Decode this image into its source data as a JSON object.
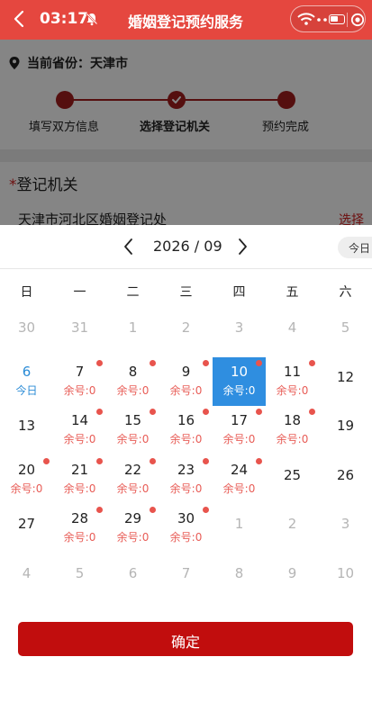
{
  "status_bar": {
    "time": "03:17"
  },
  "header": {
    "title": "婚姻登记预约服务"
  },
  "province": {
    "label": "当前省份：",
    "value": "天津市"
  },
  "steps": [
    {
      "label": "填写双方信息"
    },
    {
      "label": "选择登记机关"
    },
    {
      "label": "预约完成"
    }
  ],
  "registry": {
    "required_mark": "*",
    "label": "登记机关",
    "value": "天津市河北区婚姻登记处",
    "choose_label": "选择"
  },
  "calendar": {
    "month_title": "2026 / 09",
    "today_label": "今日",
    "weekdays": [
      "日",
      "一",
      "二",
      "三",
      "四",
      "五",
      "六"
    ],
    "days": [
      {
        "d": "30",
        "state": "muted"
      },
      {
        "d": "31",
        "state": "muted"
      },
      {
        "d": "1",
        "state": "muted"
      },
      {
        "d": "2",
        "state": "muted"
      },
      {
        "d": "3",
        "state": "muted"
      },
      {
        "d": "4",
        "state": "muted"
      },
      {
        "d": "5",
        "state": "muted"
      },
      {
        "d": "6",
        "sub": "今日",
        "state": "today"
      },
      {
        "d": "7",
        "sub": "余号:0",
        "dot": true
      },
      {
        "d": "8",
        "sub": "余号:0",
        "dot": true
      },
      {
        "d": "9",
        "sub": "余号:0",
        "dot": true
      },
      {
        "d": "10",
        "sub": "余号:0",
        "dot": true,
        "state": "selected"
      },
      {
        "d": "11",
        "sub": "余号:0",
        "dot": true
      },
      {
        "d": "12"
      },
      {
        "d": "13"
      },
      {
        "d": "14",
        "sub": "余号:0",
        "dot": true
      },
      {
        "d": "15",
        "sub": "余号:0",
        "dot": true
      },
      {
        "d": "16",
        "sub": "余号:0",
        "dot": true
      },
      {
        "d": "17",
        "sub": "余号:0",
        "dot": true
      },
      {
        "d": "18",
        "sub": "余号:0",
        "dot": true
      },
      {
        "d": "19"
      },
      {
        "d": "20",
        "sub": "余号:0",
        "dot": true
      },
      {
        "d": "21",
        "sub": "余号:0",
        "dot": true
      },
      {
        "d": "22",
        "sub": "余号:0",
        "dot": true
      },
      {
        "d": "23",
        "sub": "余号:0",
        "dot": true
      },
      {
        "d": "24",
        "sub": "余号:0",
        "dot": true
      },
      {
        "d": "25"
      },
      {
        "d": "26"
      },
      {
        "d": "27"
      },
      {
        "d": "28",
        "sub": "余号:0",
        "dot": true
      },
      {
        "d": "29",
        "sub": "余号:0",
        "dot": true
      },
      {
        "d": "30",
        "sub": "余号:0",
        "dot": true
      },
      {
        "d": "1",
        "state": "muted"
      },
      {
        "d": "2",
        "state": "muted"
      },
      {
        "d": "3",
        "state": "muted"
      },
      {
        "d": "4",
        "state": "muted"
      },
      {
        "d": "5",
        "state": "muted"
      },
      {
        "d": "6",
        "state": "muted"
      },
      {
        "d": "7",
        "state": "muted"
      },
      {
        "d": "8",
        "state": "muted"
      },
      {
        "d": "9",
        "state": "muted"
      },
      {
        "d": "10",
        "state": "muted"
      }
    ]
  },
  "confirm_label": "确定",
  "colors": {
    "header": "#e5473f",
    "brand_dark": "#a31d1d",
    "selected": "#2f8ee0",
    "confirm": "#c10d0d",
    "remaining": "#e85d57"
  }
}
